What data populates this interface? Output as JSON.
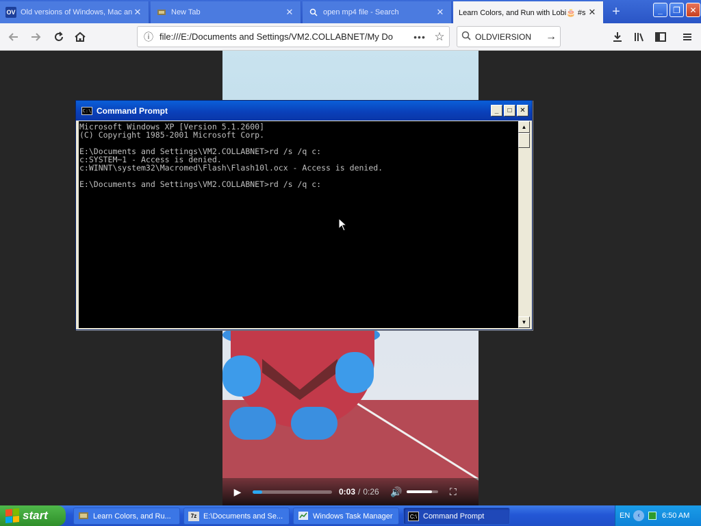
{
  "browser": {
    "tabs": [
      {
        "favicon": "OV",
        "title": "Old versions of Windows, Mac an",
        "active": false
      },
      {
        "favicon": "tab-icon",
        "title": "New Tab",
        "active": false
      },
      {
        "favicon": "search-icon",
        "title": "open mp4 file - Search",
        "active": false
      },
      {
        "favicon": "",
        "title": "Learn Colors, and Run with Lobi🎂 #s",
        "active": true
      }
    ],
    "new_tab_label": "+",
    "url": "file:///E:/Documents and Settings/VM2.COLLABNET/My Do",
    "search_text": "OLDVIERSION"
  },
  "video": {
    "current_time": "0:03",
    "separator": "/",
    "total_time": "0:26",
    "progress_fraction": 0.12,
    "volume_fraction": 0.8
  },
  "cmd": {
    "title": "Command Prompt",
    "icon_label": "C:\\",
    "lines": [
      "Microsoft Windows XP [Version 5.1.2600]",
      "(C) Copyright 1985-2001 Microsoft Corp.",
      "",
      "E:\\Documents and Settings\\VM2.COLLABNET>rd /s /q c:",
      "c:SYSTEM~1 - Access is denied.",
      "c:WINNT\\system32\\Macromed\\Flash\\Flash10l.ocx - Access is denied.",
      "",
      "E:\\Documents and Settings\\VM2.COLLABNET>rd /s /q c:"
    ]
  },
  "taskbar": {
    "start_label": "start",
    "tasks": [
      {
        "label": "Learn Colors, and Ru...",
        "active": false
      },
      {
        "label": "E:\\Documents and Se...",
        "active": false
      },
      {
        "label": "Windows Task Manager",
        "active": false
      },
      {
        "label": "Command Prompt",
        "active": true
      }
    ],
    "lang": "EN",
    "clock": "6:50 AM"
  },
  "colors": {
    "xp_blue": "#245edb",
    "start_green": "#3c9b35",
    "console_bg": "#000000",
    "console_fg": "#c0c0c0",
    "video_progress": "#2ba7f0"
  }
}
